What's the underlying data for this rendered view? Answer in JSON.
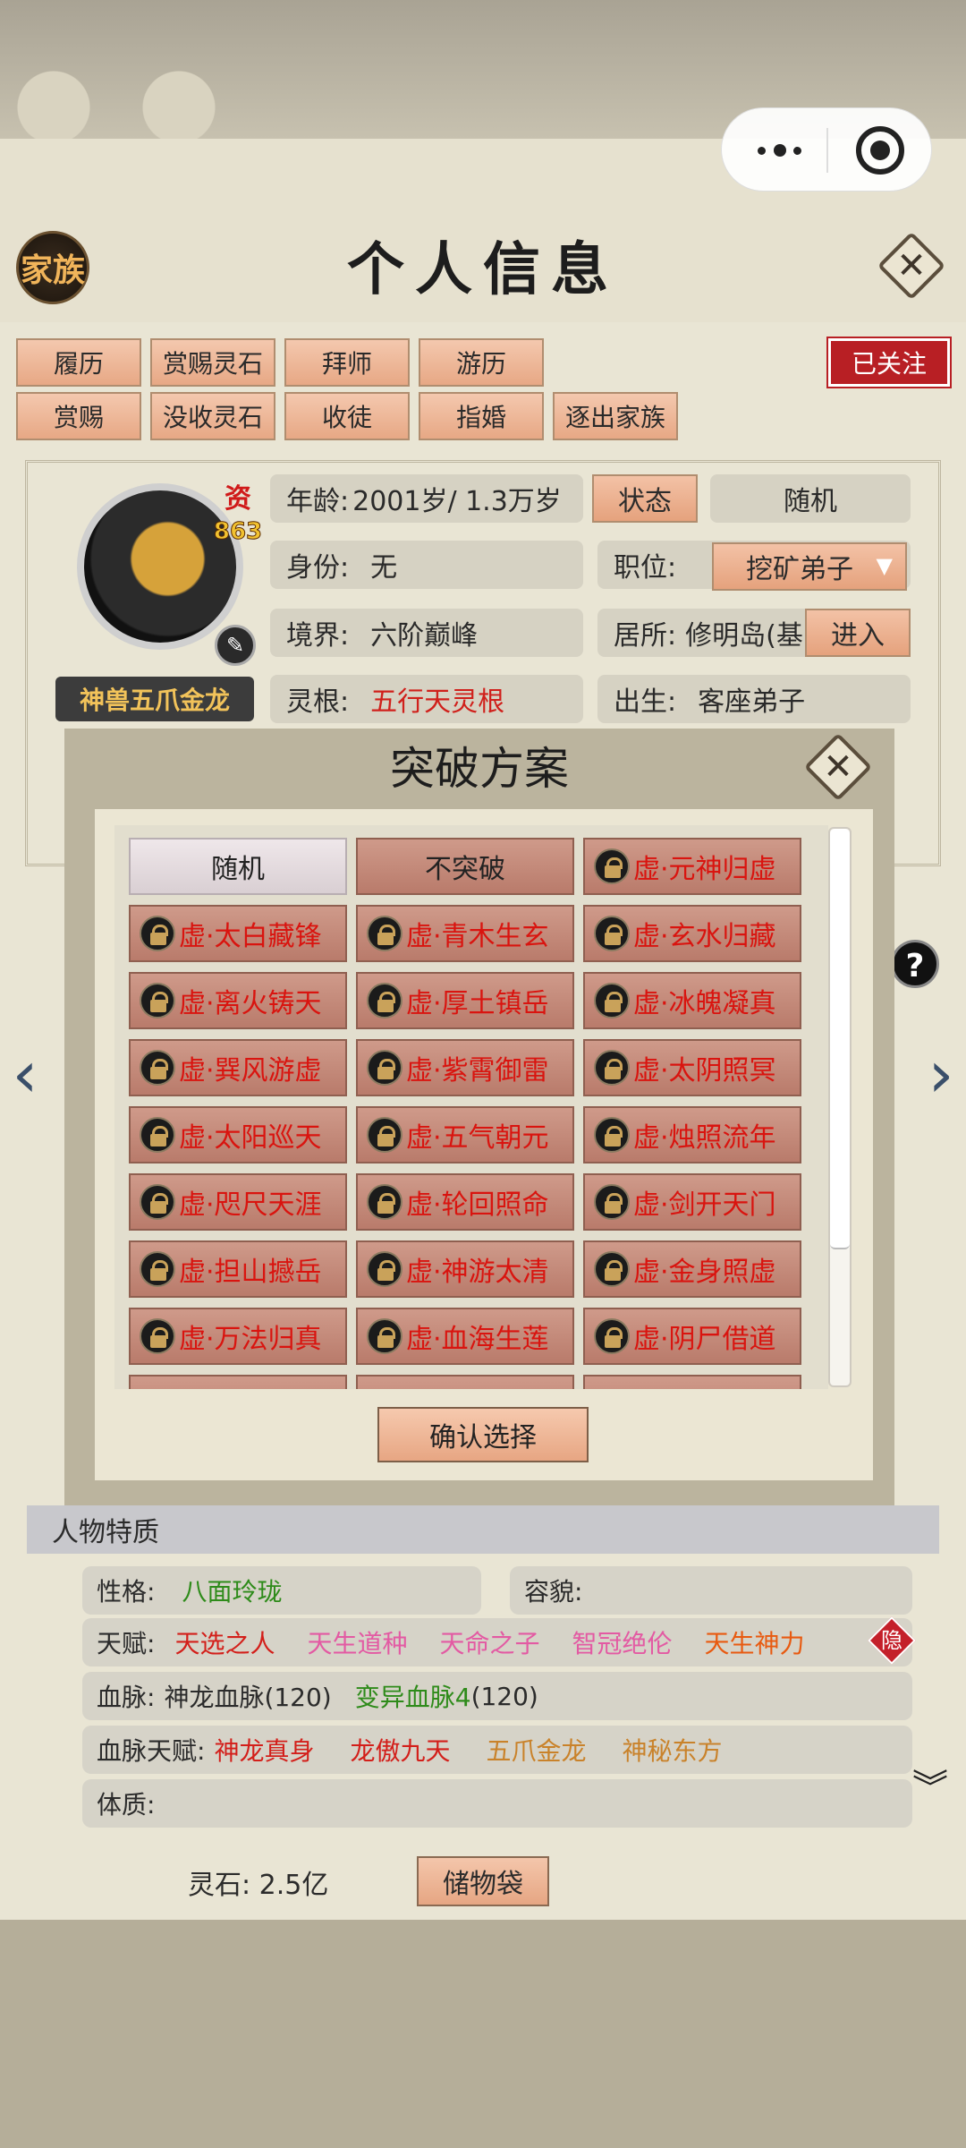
{
  "header": {
    "family_label": "家族",
    "title": "个人信息"
  },
  "tabs_row1": [
    "履历",
    "赏赐灵石",
    "拜师",
    "游历"
  ],
  "tabs_row2": [
    "赏赐",
    "没收灵石",
    "收徒",
    "指婚",
    "逐出家族"
  ],
  "followed_label": "已关注",
  "character": {
    "badge_char": "资",
    "aptitude": "863",
    "name": "神兽五爪金龙",
    "age_label": "年龄:",
    "age_value": "2001岁/ 1.3万岁",
    "status_button": "状态",
    "random_button": "随机",
    "identity_label": "身份:",
    "identity_value": "无",
    "position_label": "职位:",
    "position_value": "挖矿弟子",
    "realm_label": "境界:",
    "realm_value": "六阶巅峰",
    "residence_label": "居所:",
    "residence_value": "修明岛(基",
    "enter_button": "进入",
    "root_label": "灵根:",
    "root_value": "五行天灵根",
    "birth_label": "出生:",
    "birth_value": "客座弟子"
  },
  "modal": {
    "title": "突破方案",
    "options": [
      {
        "label": "随机",
        "locked": false
      },
      {
        "label": "不突破",
        "locked": false
      },
      {
        "label": "虚·元神归虚",
        "locked": true
      },
      {
        "label": "虚·太白藏锋",
        "locked": true
      },
      {
        "label": "虚·青木生玄",
        "locked": true
      },
      {
        "label": "虚·玄水归藏",
        "locked": true
      },
      {
        "label": "虚·离火铸天",
        "locked": true
      },
      {
        "label": "虚·厚土镇岳",
        "locked": true
      },
      {
        "label": "虚·冰魄凝真",
        "locked": true
      },
      {
        "label": "虚·巽风游虚",
        "locked": true
      },
      {
        "label": "虚·紫霄御雷",
        "locked": true
      },
      {
        "label": "虚·太阴照冥",
        "locked": true
      },
      {
        "label": "虚·太阳巡天",
        "locked": true
      },
      {
        "label": "虚·五气朝元",
        "locked": true
      },
      {
        "label": "虚·烛照流年",
        "locked": true
      },
      {
        "label": "虚·咫尺天涯",
        "locked": true
      },
      {
        "label": "虚·轮回照命",
        "locked": true
      },
      {
        "label": "虚·剑开天门",
        "locked": true
      },
      {
        "label": "虚·担山撼岳",
        "locked": true
      },
      {
        "label": "虚·神游太清",
        "locked": true
      },
      {
        "label": "虚·金身照虚",
        "locked": true
      },
      {
        "label": "虚·万法归真",
        "locked": true
      },
      {
        "label": "虚·血海生莲",
        "locked": true
      },
      {
        "label": "虚·阴尸借道",
        "locked": true
      }
    ],
    "confirm_label": "确认选择"
  },
  "traits": {
    "header": "人物特质",
    "personality_label": "性格:",
    "personality_value": "八面玲珑",
    "looks_label": "容貌:",
    "talent_label": "天赋:",
    "talents": [
      {
        "text": "天选之人",
        "color": "#d31f1a"
      },
      {
        "text": "天生道种",
        "color": "#e35aa3"
      },
      {
        "text": "天命之子",
        "color": "#e35aa3"
      },
      {
        "text": "智冠绝伦",
        "color": "#e35aa3"
      },
      {
        "text": "天生神力",
        "color": "#e85a10"
      }
    ],
    "hidden_label": "隐",
    "bloodline_label": "血脉:",
    "bloodline_main": "神龙血脉(120)",
    "bloodline_mutant_name": "变异血脉4",
    "bloodline_mutant_value": "(120)",
    "bloodline_talent_label": "血脉天赋:",
    "bloodline_talents": [
      {
        "text": "神龙真身",
        "color": "#d31f1a"
      },
      {
        "text": "龙傲九天",
        "color": "#d31f1a"
      },
      {
        "text": "五爪金龙",
        "color": "#c9822a"
      },
      {
        "text": "神秘东方",
        "color": "#c9822a"
      }
    ],
    "physique_label": "体质:"
  },
  "footer": {
    "spirit_stone": "灵石:  2.5亿",
    "storage_label": "储物袋"
  }
}
